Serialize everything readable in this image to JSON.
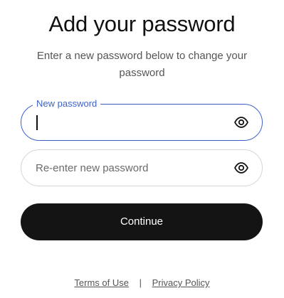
{
  "page": {
    "title": "Add your password",
    "subtitle": "Enter a new password below to change your password"
  },
  "form": {
    "new_password": {
      "label": "New password",
      "value": "",
      "placeholder": "",
      "toggle_icon": "eye-icon"
    },
    "reenter_password": {
      "value": "",
      "placeholder": "Re-enter new password",
      "toggle_icon": "eye-icon"
    },
    "continue_label": "Continue"
  },
  "footer": {
    "terms_label": "Terms of Use",
    "separator": "|",
    "privacy_label": "Privacy Policy"
  },
  "colors": {
    "accent": "#3d63c9",
    "button_bg": "#141414",
    "button_text": "#ffffff",
    "muted_text": "#555555",
    "border": "#d6d6d6"
  }
}
